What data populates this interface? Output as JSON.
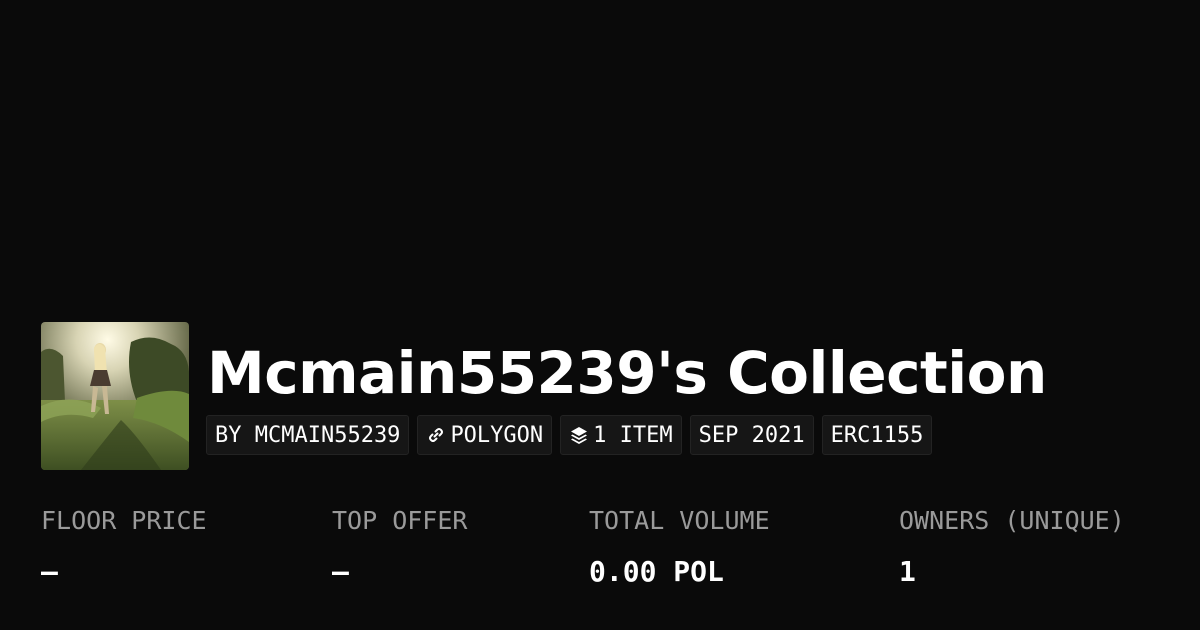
{
  "collection": {
    "title": "Mcmain55239's Collection",
    "avatar_icon": "collection-avatar-photo"
  },
  "badges": {
    "creator": "BY MCMAIN55239",
    "chain": "POLYGON",
    "chain_icon": "link-icon",
    "items": "1 ITEM",
    "items_icon": "layers-icon",
    "date": "SEP 2021",
    "standard": "ERC1155"
  },
  "stats": {
    "floor_price": {
      "label": "FLOOR PRICE",
      "value": "–"
    },
    "top_offer": {
      "label": "TOP OFFER",
      "value": "–"
    },
    "total_volume": {
      "label": "TOTAL VOLUME",
      "value": "0.00 POL"
    },
    "owners": {
      "label": "OWNERS (UNIQUE)",
      "value": "1"
    }
  }
}
